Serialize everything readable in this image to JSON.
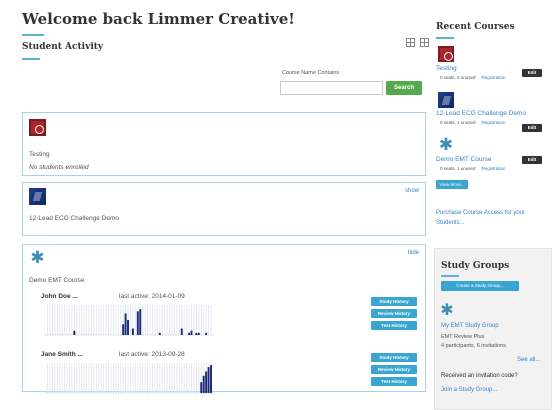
{
  "main": {
    "title": "Welcome back Limmer Creative!",
    "section_title": "Student Activity",
    "search": {
      "label": "Course Name Contains",
      "value": "",
      "placeholder": "",
      "button": "Search"
    },
    "courses": [
      {
        "name": "Testing",
        "note": "No students enrolled",
        "icon": "red-cross-logo"
      },
      {
        "name": "12-Lead ECG Challenge Demo",
        "toggle": "show",
        "icon": "ecg-heart-logo"
      },
      {
        "name": "Demo EMT Course",
        "toggle": "hide",
        "icon": "star-of-life-logo",
        "students": [
          {
            "name": "John Doe ...",
            "last_active": "last active: 2014-01-09",
            "activity": [
              0,
              0,
              0,
              0,
              0,
              0,
              0,
              0,
              0,
              0,
              0,
              2,
              0,
              0,
              0,
              0,
              0,
              0,
              0,
              0,
              0,
              0,
              0,
              0,
              0,
              0,
              0,
              0,
              0,
              0,
              0,
              5,
              10,
              7,
              0,
              3,
              0,
              11,
              12,
              0,
              0,
              0,
              0,
              0,
              0,
              0,
              1,
              0,
              0,
              0,
              0,
              0,
              0,
              0,
              0,
              3,
              0,
              0,
              1,
              2,
              0,
              1,
              1,
              0,
              0,
              1,
              0,
              0
            ]
          },
          {
            "name": "Jane Smith ...",
            "last_active": "last active: 2013-09-28",
            "activity": [
              0,
              0,
              0,
              0,
              0,
              0,
              0,
              0,
              0,
              0,
              0,
              0,
              0,
              0,
              0,
              0,
              0,
              0,
              0,
              0,
              0,
              0,
              0,
              0,
              0,
              0,
              0,
              0,
              0,
              0,
              0,
              0,
              0,
              0,
              0,
              0,
              0,
              0,
              0,
              0,
              0,
              0,
              0,
              0,
              0,
              0,
              0,
              0,
              0,
              0,
              0,
              0,
              0,
              0,
              0,
              0,
              0,
              0,
              0,
              0,
              0,
              0,
              0,
              5,
              8,
              10,
              12,
              13
            ]
          }
        ],
        "actions": [
          "Study History",
          "Review History",
          "Test History"
        ]
      }
    ]
  },
  "sidebar": {
    "recent_title": "Recent Courses",
    "recent": [
      {
        "name": "Testing",
        "meta": "0 seats, 0 unused",
        "registration": "Registration",
        "edit": "Edit"
      },
      {
        "name": "12-Lead ECG Challenge Demo",
        "meta": "0 seats, 1 unused",
        "registration": "Registration",
        "edit": "Edit"
      },
      {
        "name": "Demo EMT Course",
        "meta": "0 seats, 1 unused",
        "registration": "Registration",
        "edit": "Edit"
      }
    ],
    "view_more": "View more...",
    "purchase": "Purchase Course Access for your Students...",
    "study": {
      "title": "Study Groups",
      "create": "Create a Study Group...",
      "group_name": "My EMT Study Group",
      "group_course": "EMT Review Plus",
      "group_meta": "4 participants, 6 invitations",
      "see_all": "See all...",
      "invite_question": "Received an invitation code?",
      "join": "Join a Study Group..."
    }
  },
  "colors": {
    "accent": "#5bb4d8",
    "button_blue": "#3aa6cf",
    "search_green": "#55a84b",
    "bar_navy": "#1e2a78",
    "link": "#3a82c4"
  }
}
